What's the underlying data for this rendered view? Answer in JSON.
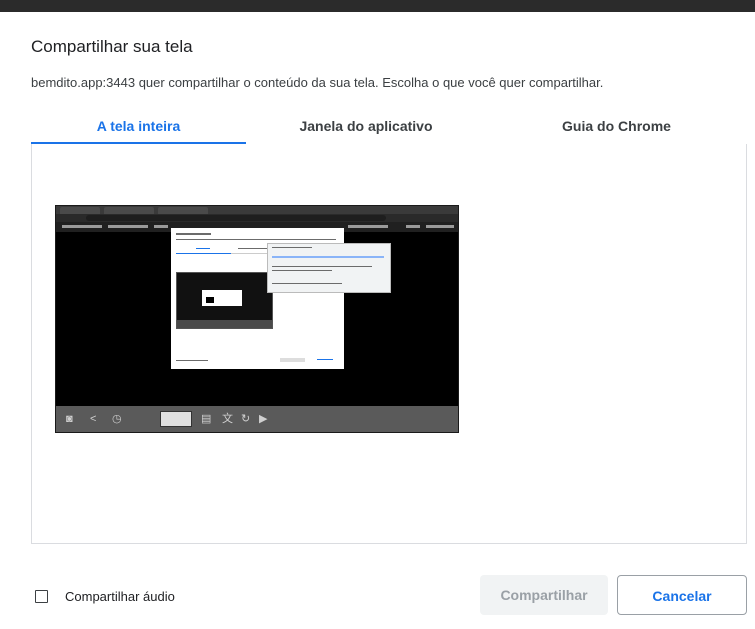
{
  "dialog": {
    "title": "Compartilhar sua tela",
    "subtitle": "bemdito.app:3443 quer compartilhar o conteúdo da sua tela. Escolha o que você quer compartilhar."
  },
  "tabs": [
    {
      "label": "A tela inteira",
      "selected": true
    },
    {
      "label": "Janela do aplicativo",
      "selected": false
    },
    {
      "label": "Guia do Chrome",
      "selected": false
    }
  ],
  "preview": {
    "description_icons": [
      "camera-icon",
      "share-icon",
      "timer-icon",
      "subtitles-icon",
      "translate-icon",
      "refresh-icon",
      "play-icon"
    ]
  },
  "audio_checkbox": {
    "label": "Compartilhar áudio",
    "checked": false
  },
  "buttons": {
    "share": {
      "label": "Compartilhar",
      "enabled": false
    },
    "cancel": {
      "label": "Cancelar",
      "enabled": true
    }
  },
  "colors": {
    "accent": "#1a73e8",
    "disabled_bg": "#f1f3f4",
    "disabled_text": "#9aa0a6"
  }
}
